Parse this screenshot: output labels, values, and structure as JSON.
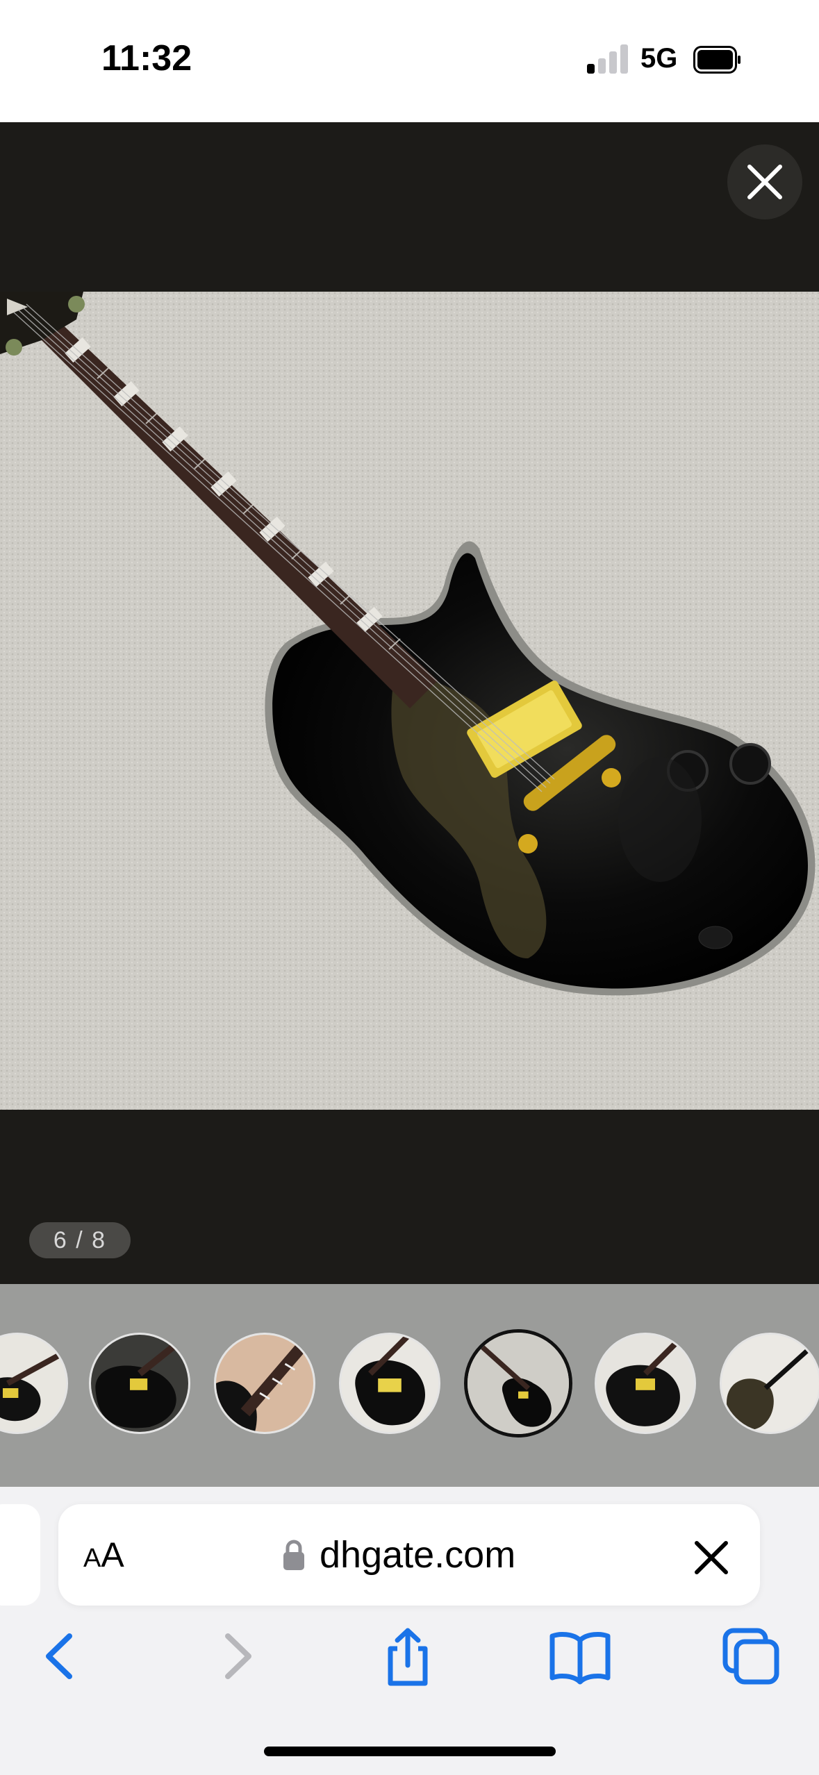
{
  "status_bar": {
    "time": "11:32",
    "network": "5G",
    "signal_bars_active": 1,
    "signal_bars_total": 4,
    "battery_level": 0.9
  },
  "viewer": {
    "counter": "6 / 8",
    "current_index": 6,
    "total": 8,
    "close_icon": "close-icon",
    "photo_subject": "black electric guitar with gold hardware on carpet",
    "thumbnails": [
      {
        "label": "thumb-1"
      },
      {
        "label": "thumb-2"
      },
      {
        "label": "thumb-3"
      },
      {
        "label": "thumb-4"
      },
      {
        "label": "thumb-5",
        "active": true
      },
      {
        "label": "thumb-6"
      },
      {
        "label": "thumb-7"
      }
    ]
  },
  "browser": {
    "aa_label_small": "A",
    "aa_label_large": "A",
    "domain": "dhgate.com",
    "lock_icon": "lock-icon",
    "clear_icon": "close-icon",
    "toolbar": [
      "back-icon",
      "forward-icon",
      "share-icon",
      "bookmarks-icon",
      "tabs-icon"
    ]
  },
  "colors": {
    "viewer_bg": "#1c1b18",
    "strip_bg": "#9b9c9a",
    "accent": "#1a73e8",
    "disabled": "#b7b7bb"
  }
}
